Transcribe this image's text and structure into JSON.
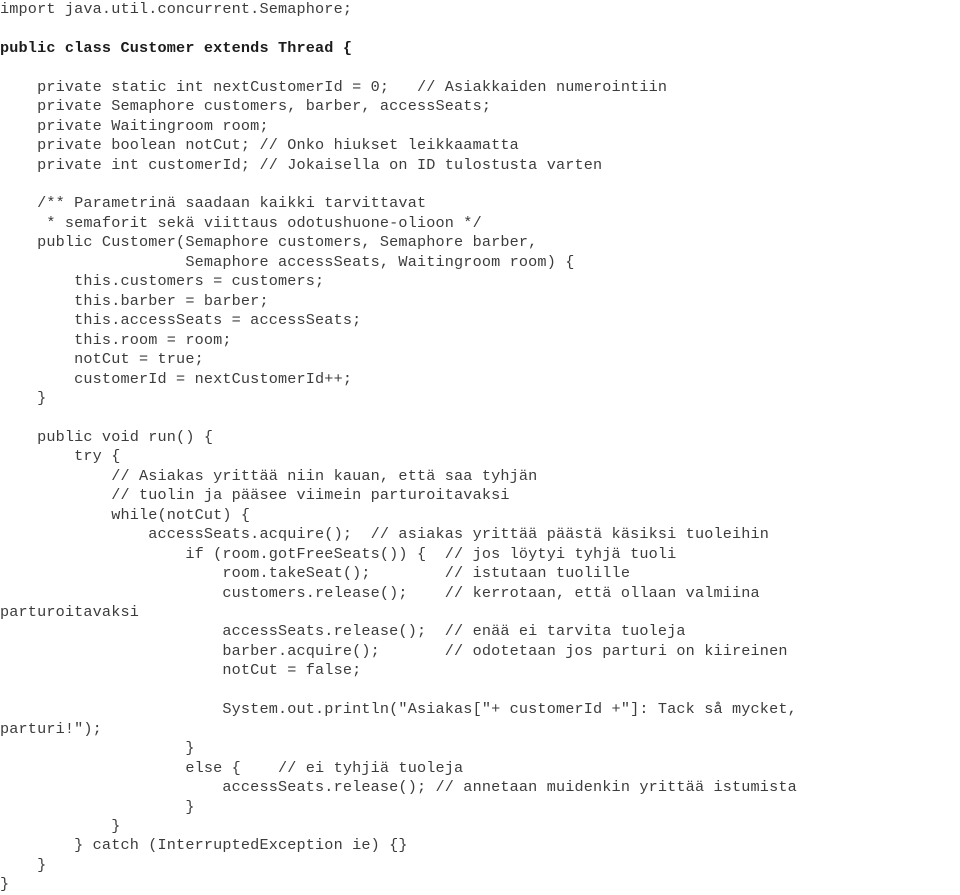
{
  "document": {
    "kind": "source-code-listing",
    "language": "Java",
    "file_title": "Customer.java",
    "background_color": "#ffffff",
    "text_color": "#3c3c3c",
    "bold_text_color": "#1c1c1c"
  },
  "code": {
    "lines": [
      {
        "text": "import java.util.concurrent.Semaphore;",
        "bold": false
      },
      {
        "text": "",
        "bold": false
      },
      {
        "text": "public class Customer extends Thread {",
        "bold": true
      },
      {
        "text": "",
        "bold": false
      },
      {
        "text": "    private static int nextCustomerId = 0;   // Asiakkaiden numerointiin",
        "bold": false
      },
      {
        "text": "    private Semaphore customers, barber, accessSeats;",
        "bold": false
      },
      {
        "text": "    private Waitingroom room;",
        "bold": false
      },
      {
        "text": "    private boolean notCut; // Onko hiukset leikkaamatta",
        "bold": false
      },
      {
        "text": "    private int customerId; // Jokaisella on ID tulostusta varten",
        "bold": false
      },
      {
        "text": "",
        "bold": false
      },
      {
        "text": "    /** Parametrinä saadaan kaikki tarvittavat",
        "bold": false
      },
      {
        "text": "     * semaforit sekä viittaus odotushuone-olioon */",
        "bold": false
      },
      {
        "text": "    public Customer(Semaphore customers, Semaphore barber,",
        "bold": false
      },
      {
        "text": "                    Semaphore accessSeats, Waitingroom room) {",
        "bold": false
      },
      {
        "text": "        this.customers = customers;",
        "bold": false
      },
      {
        "text": "        this.barber = barber;",
        "bold": false
      },
      {
        "text": "        this.accessSeats = accessSeats;",
        "bold": false
      },
      {
        "text": "        this.room = room;",
        "bold": false
      },
      {
        "text": "        notCut = true;",
        "bold": false
      },
      {
        "text": "        customerId = nextCustomerId++;",
        "bold": false
      },
      {
        "text": "    }",
        "bold": false
      },
      {
        "text": "",
        "bold": false
      },
      {
        "text": "    public void run() {",
        "bold": false
      },
      {
        "text": "        try {",
        "bold": false
      },
      {
        "text": "            // Asiakas yrittää niin kauan, että saa tyhjän",
        "bold": false
      },
      {
        "text": "            // tuolin ja pääsee viimein parturoitavaksi",
        "bold": false
      },
      {
        "text": "            while(notCut) {",
        "bold": false
      },
      {
        "text": "                accessSeats.acquire();  // asiakas yrittää päästä käsiksi tuoleihin",
        "bold": false
      },
      {
        "text": "                    if (room.gotFreeSeats()) {  // jos löytyi tyhjä tuoli",
        "bold": false
      },
      {
        "text": "                        room.takeSeat();        // istutaan tuolille",
        "bold": false
      },
      {
        "text": "                        customers.release();    // kerrotaan, että ollaan valmiina",
        "bold": false
      },
      {
        "text": "parturoitavaksi",
        "bold": false
      },
      {
        "text": "                        accessSeats.release();  // enää ei tarvita tuoleja",
        "bold": false
      },
      {
        "text": "                        barber.acquire();       // odotetaan jos parturi on kiireinen",
        "bold": false
      },
      {
        "text": "                        notCut = false;",
        "bold": false
      },
      {
        "text": "",
        "bold": false
      },
      {
        "text": "                        System.out.println(\"Asiakas[\"+ customerId +\"]: Tack så mycket,",
        "bold": false
      },
      {
        "text": "parturi!\");",
        "bold": false
      },
      {
        "text": "                    }",
        "bold": false
      },
      {
        "text": "                    else {    // ei tyhjiä tuoleja",
        "bold": false
      },
      {
        "text": "                        accessSeats.release(); // annetaan muidenkin yrittää istumista",
        "bold": false
      },
      {
        "text": "                    }",
        "bold": false
      },
      {
        "text": "            }",
        "bold": false
      },
      {
        "text": "        } catch (InterruptedException ie) {}",
        "bold": false
      },
      {
        "text": "    }",
        "bold": false
      },
      {
        "text": "}",
        "bold": false
      }
    ]
  }
}
